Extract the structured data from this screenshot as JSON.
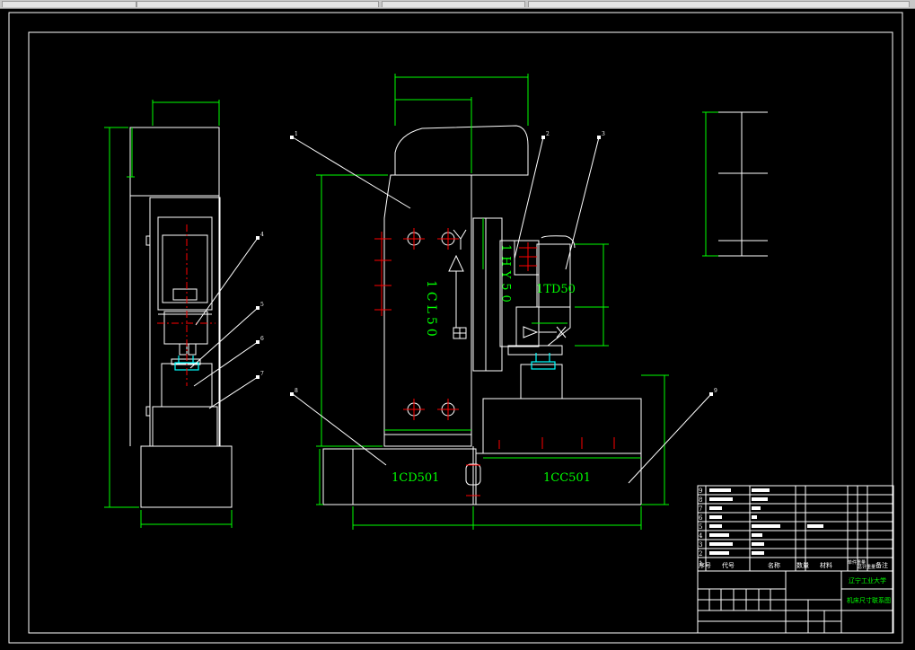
{
  "window": {
    "tab_count": 4
  },
  "drawing": {
    "unit_labels": {
      "press_main": "1CL50",
      "cylinder_box": "1HY50",
      "feed_unit": "1TD50",
      "base_left": "1CD501",
      "base_right": "1CC501"
    },
    "balloons": [
      "1",
      "2",
      "3",
      "4",
      "5",
      "6",
      "7",
      "8",
      "9"
    ],
    "title_block": {
      "header": [
        "序号",
        "代号",
        "名称",
        "数量",
        "材料",
        "单件重量",
        "总计重量",
        "备注"
      ],
      "row_numbers": [
        "9",
        "8",
        "7",
        "6",
        "5",
        "4",
        "3",
        "2",
        "1"
      ],
      "school": "辽宁工业大学",
      "drawing_title": "机床尺寸联系图"
    }
  },
  "colors": {
    "background": "#000000",
    "outline": "#ffffff",
    "dimension": "#00ff00",
    "center_line": "#ff0000",
    "leader": "#ffffff",
    "tool_highlight": "#00ffff"
  }
}
